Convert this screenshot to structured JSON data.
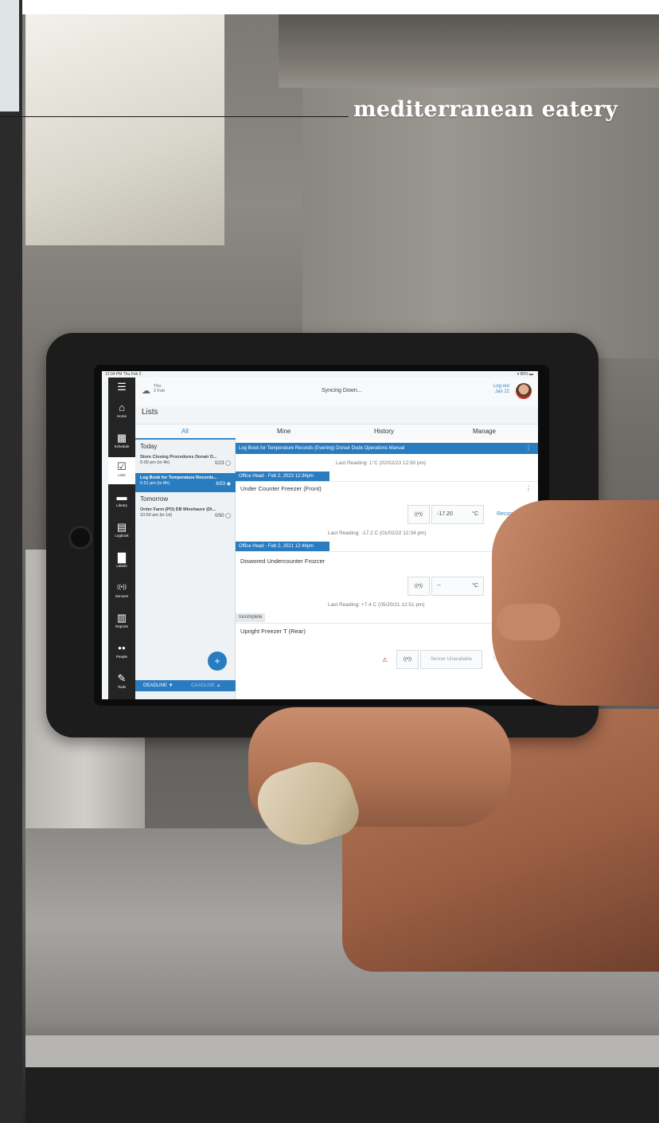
{
  "brand": {
    "title": "mediterranean eatery"
  },
  "tablet": {
    "status": {
      "time": "12:04 PM  Thu Feb 2",
      "battery": "▾ 86% ▬"
    },
    "header": {
      "date_line1": "Thu",
      "date_line2": "2 Feb",
      "sync": "Syncing Down...",
      "logout_line1": "Log out",
      "logout_line2": "Jan 22"
    },
    "nav": [
      {
        "label": "Home",
        "icon": "⌂"
      },
      {
        "label": "Schedule",
        "icon": "▦"
      },
      {
        "label": "Lists",
        "icon": "☑"
      },
      {
        "label": "Library",
        "icon": "▬"
      },
      {
        "label": "Logbook",
        "icon": "▤"
      },
      {
        "label": "Labels",
        "icon": "▇"
      },
      {
        "label": "Sensors",
        "icon": "((•))"
      },
      {
        "label": "Reports",
        "icon": "▥"
      },
      {
        "label": "People",
        "icon": "●●"
      },
      {
        "label": "Tools",
        "icon": "✎"
      }
    ],
    "menu_icon": "☰",
    "title": "Lists",
    "tabs": {
      "all": "All",
      "mine": "Mine",
      "history": "History",
      "manage": "Manage"
    },
    "sections": {
      "today": "Today",
      "tomorrow": "Tomorrow"
    },
    "list_items": [
      {
        "title": "Store Closing Procedures Donair D...",
        "sub": "5:00 pm (in 4h)",
        "count": "0/23 ◯"
      },
      {
        "title": "Log Book for Temperature Records...",
        "sub": "5:51 pm (in 8h)",
        "count": "6/53 ◉"
      },
      {
        "title": "Order Farm (PO) DB Minshaure (Di...",
        "sub": "10:50 am (in 1d)",
        "count": "0/50 ◯"
      }
    ],
    "fab": "+",
    "deadline": {
      "left": "DEADLINE ▼",
      "right": "CAADLINE ▲"
    },
    "detail": {
      "header": "Log Book for Temperature Records (Evening) Donair Dude Operations Manual",
      "header_last": "Last Reading: 1°C (02/02/23 12:50 pm)",
      "stamp1": "Office Head · Feb 2, 2023 12:34pm",
      "item1": "Under Counter Freezer (Front)",
      "item1_value": "-17.20",
      "item1_unit": "°C",
      "item1_action": "Record",
      "item1_last": "Last Reading: -17.2 C (01/02/22 12:34 pm)",
      "stamp2": "Office Head · Feb 2, 2021 12:44pm",
      "item2": "Diswored Undercounter Frozcer",
      "item2_value": "--",
      "item2_unit": "°C",
      "item2_last": "Last Reading: +7.4 C (05/20/21 12:51 pm)",
      "tag": "Incomplete",
      "item3": "Upright Freezer T (Rear)",
      "item3_sensor": "Sencer Unavailable",
      "item3_action": "Lockout",
      "kebab": "⋮",
      "sensor_icon": "((•))"
    }
  }
}
